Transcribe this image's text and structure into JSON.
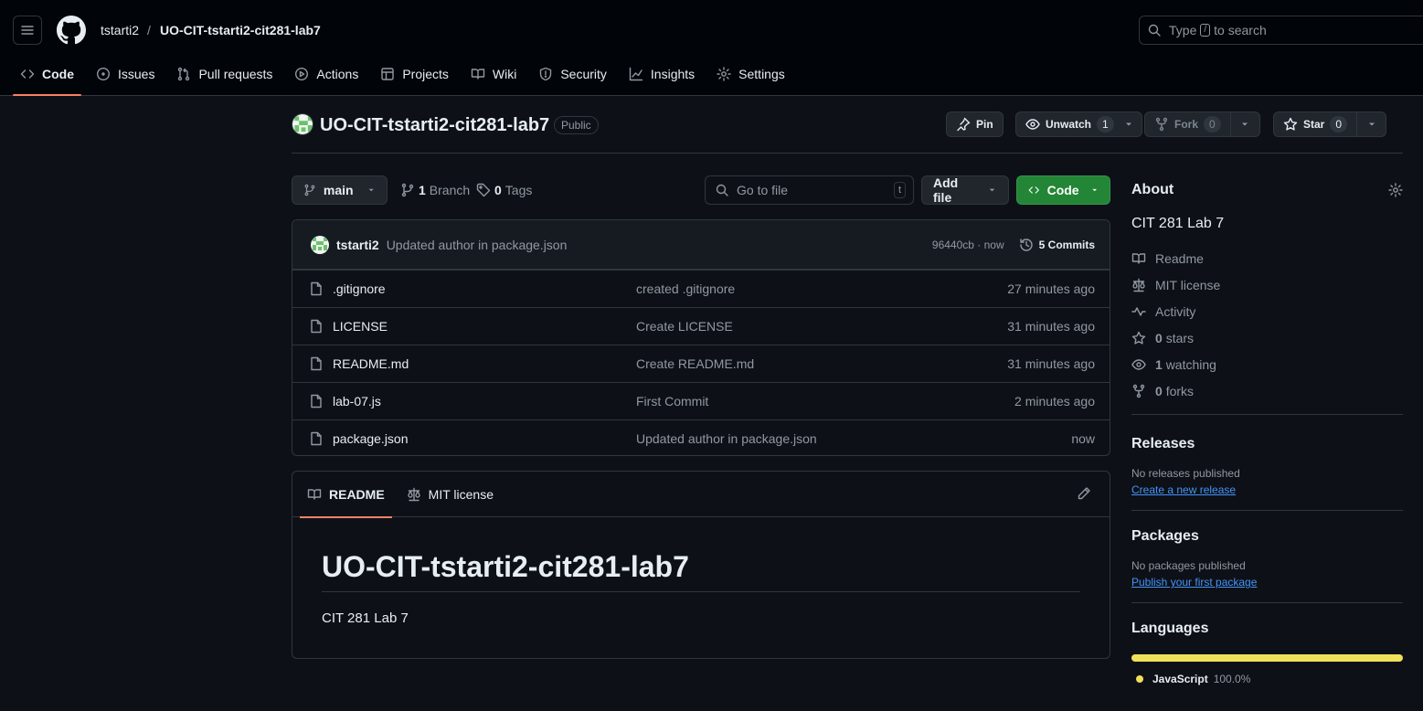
{
  "header": {
    "owner": "tstarti2",
    "separator": "/",
    "repo": "UO-CIT-tstarti2-cit281-lab7",
    "search_before": "Type",
    "search_key": "/",
    "search_after": "to search"
  },
  "nav": {
    "tabs": [
      {
        "label": "Code",
        "icon": "code-icon"
      },
      {
        "label": "Issues",
        "icon": "issue-icon"
      },
      {
        "label": "Pull requests",
        "icon": "pull-request-icon"
      },
      {
        "label": "Actions",
        "icon": "play-icon"
      },
      {
        "label": "Projects",
        "icon": "table-icon"
      },
      {
        "label": "Wiki",
        "icon": "book-icon"
      },
      {
        "label": "Security",
        "icon": "shield-icon"
      },
      {
        "label": "Insights",
        "icon": "graph-icon"
      },
      {
        "label": "Settings",
        "icon": "gear-icon"
      }
    ]
  },
  "repo": {
    "title": "UO-CIT-tstarti2-cit281-lab7",
    "visibility": "Public",
    "pin_label": "Pin",
    "unwatch_label": "Unwatch",
    "watch_count": "1",
    "fork_label": "Fork",
    "fork_count": "0",
    "star_label": "Star",
    "star_count": "0"
  },
  "toolbar": {
    "branch": "main",
    "branch_count": "1",
    "branch_label": "Branch",
    "tag_count": "0",
    "tag_label": "Tags",
    "goto_placeholder": "Go to file",
    "goto_key": "t",
    "add_file_label": "Add file",
    "code_label": "Code"
  },
  "latest_commit": {
    "author": "tstarti2",
    "message": "Updated author in package.json",
    "hash_time": "96440cb · now",
    "commits_label": "5 Commits"
  },
  "files": [
    {
      "name": ".gitignore",
      "message": "created .gitignore",
      "age": "27 minutes ago"
    },
    {
      "name": "LICENSE",
      "message": "Create LICENSE",
      "age": "31 minutes ago"
    },
    {
      "name": "README.md",
      "message": "Create README.md",
      "age": "31 minutes ago"
    },
    {
      "name": "lab-07.js",
      "message": "First Commit",
      "age": "2 minutes ago"
    },
    {
      "name": "package.json",
      "message": "Updated author in package.json",
      "age": "now"
    }
  ],
  "readme": {
    "tab_readme": "README",
    "tab_license": "MIT license",
    "heading": "UO-CIT-tstarti2-cit281-lab7",
    "body": "CIT 281 Lab 7"
  },
  "about": {
    "title": "About",
    "description": "CIT 281 Lab 7",
    "readme": "Readme",
    "license": "MIT license",
    "activity": "Activity",
    "stars_count": "0",
    "stars_label": "stars",
    "watching_count": "1",
    "watching_label": "watching",
    "forks_count": "0",
    "forks_label": "forks"
  },
  "releases": {
    "title": "Releases",
    "empty": "No releases published",
    "link": "Create a new release"
  },
  "packages": {
    "title": "Packages",
    "empty": "No packages published",
    "link": "Publish your first package"
  },
  "languages": {
    "title": "Languages",
    "items": [
      {
        "name": "JavaScript",
        "percent": "100.0%",
        "color": "#f1e05a"
      }
    ]
  },
  "colors": {
    "background": "#0d1117",
    "header_bg": "#010409",
    "accent_tab": "#f78166",
    "code_button": "#238636",
    "link": "#4493f8"
  }
}
